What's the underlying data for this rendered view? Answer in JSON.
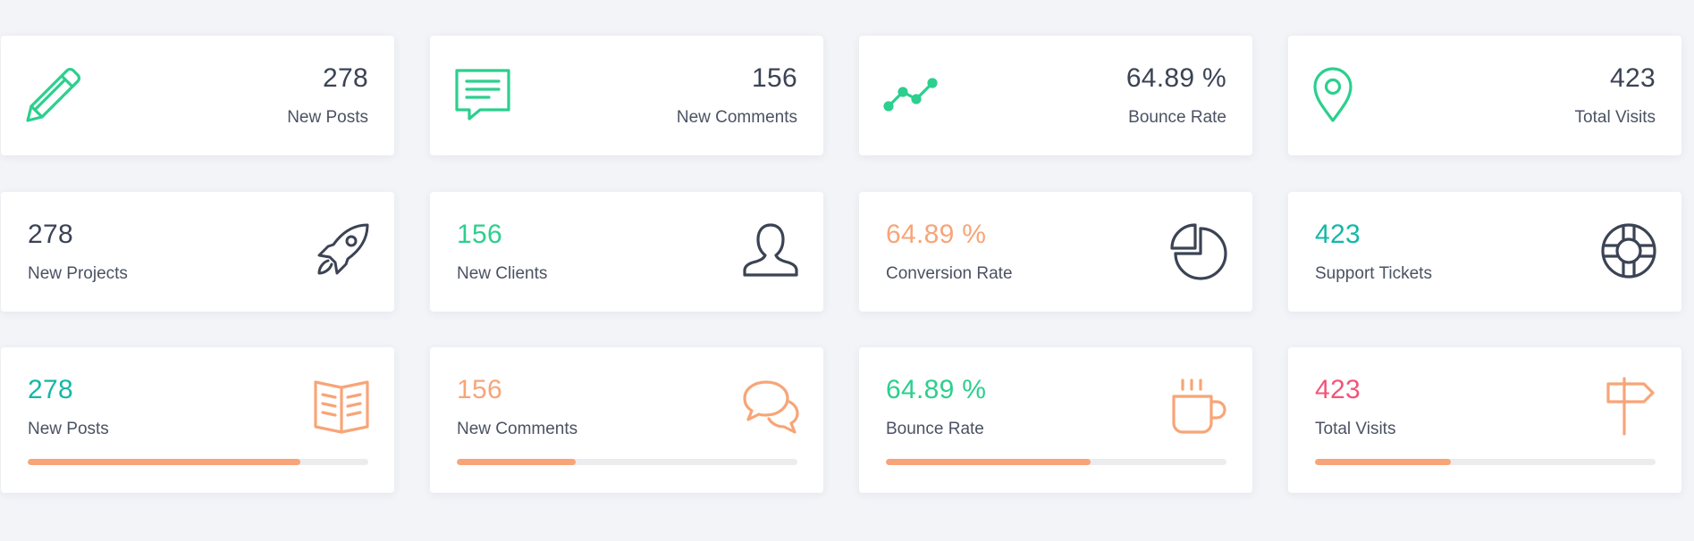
{
  "colors": {
    "green": "#2ccf8e",
    "teal": "#14b8a6",
    "orange": "#f7a578",
    "red": "#f2557a",
    "dark": "#3b4354",
    "bar_fill": "#f7a578",
    "bar_track": "#ececee"
  },
  "row1": [
    {
      "value": "278",
      "label": "New Posts",
      "icon": "pencil-icon"
    },
    {
      "value": "156",
      "label": "New Comments",
      "icon": "comment-icon"
    },
    {
      "value": "64.89 %",
      "label": "Bounce Rate",
      "icon": "line-graph-icon"
    },
    {
      "value": "423",
      "label": "Total Visits",
      "icon": "map-pin-icon"
    }
  ],
  "row2": [
    {
      "value": "278",
      "label": "New Projects",
      "icon": "rocket-icon"
    },
    {
      "value": "156",
      "label": "New Clients",
      "icon": "user-icon"
    },
    {
      "value": "64.89 %",
      "label": "Conversion Rate",
      "icon": "pie-chart-icon"
    },
    {
      "value": "423",
      "label": "Support Tickets",
      "icon": "lifebuoy-icon"
    }
  ],
  "row3": [
    {
      "value": "278",
      "label": "New Posts",
      "icon": "book-icon",
      "progress": 0.8
    },
    {
      "value": "156",
      "label": "New Comments",
      "icon": "chat-bubbles-icon",
      "progress": 0.35
    },
    {
      "value": "64.89 %",
      "label": "Bounce Rate",
      "icon": "coffee-cup-icon",
      "progress": 0.6
    },
    {
      "value": "423",
      "label": "Total Visits",
      "icon": "signpost-icon",
      "progress": 0.4
    }
  ]
}
